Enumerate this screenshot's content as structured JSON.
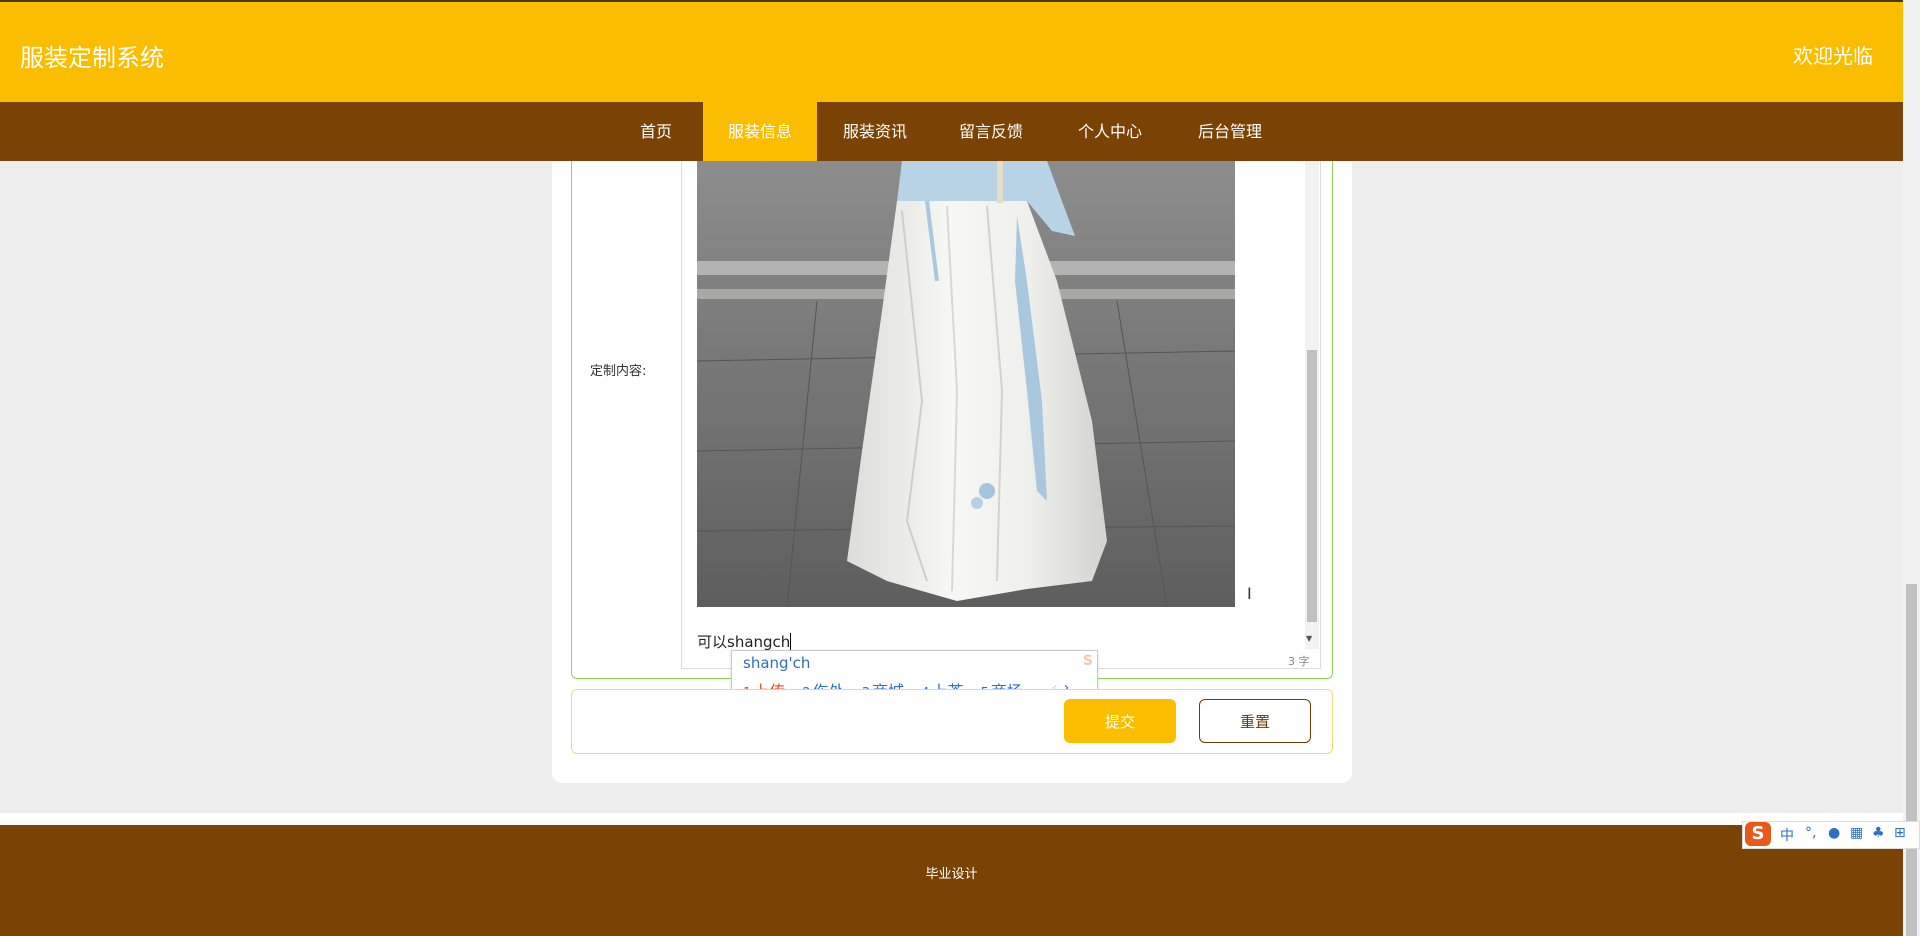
{
  "header": {
    "site_title": "服装定制系统",
    "welcome": "欢迎光临"
  },
  "nav": {
    "items": [
      {
        "label": "首页"
      },
      {
        "label": "服装信息"
      },
      {
        "label": "服装资讯"
      },
      {
        "label": "留言反馈"
      },
      {
        "label": "个人中心"
      },
      {
        "label": "后台管理"
      }
    ],
    "active": "服装信息"
  },
  "form": {
    "content_label": "定制内容:",
    "editor_text": "可以shangch",
    "word_count": "3 字"
  },
  "ime": {
    "composition": "shang'ch",
    "candidates": [
      {
        "num": "1",
        "text": "上传"
      },
      {
        "num": "2",
        "text": "伤处"
      },
      {
        "num": "3",
        "text": "商城"
      },
      {
        "num": "4",
        "text": "上茶"
      },
      {
        "num": "5",
        "text": "商场"
      }
    ],
    "toolbar": {
      "mode": "中"
    }
  },
  "buttons": {
    "submit": "提交",
    "reset": "重置"
  },
  "footer": {
    "text": "毕业设计"
  },
  "colors": {
    "accent": "#fbbd00",
    "brown": "#7a4205"
  }
}
